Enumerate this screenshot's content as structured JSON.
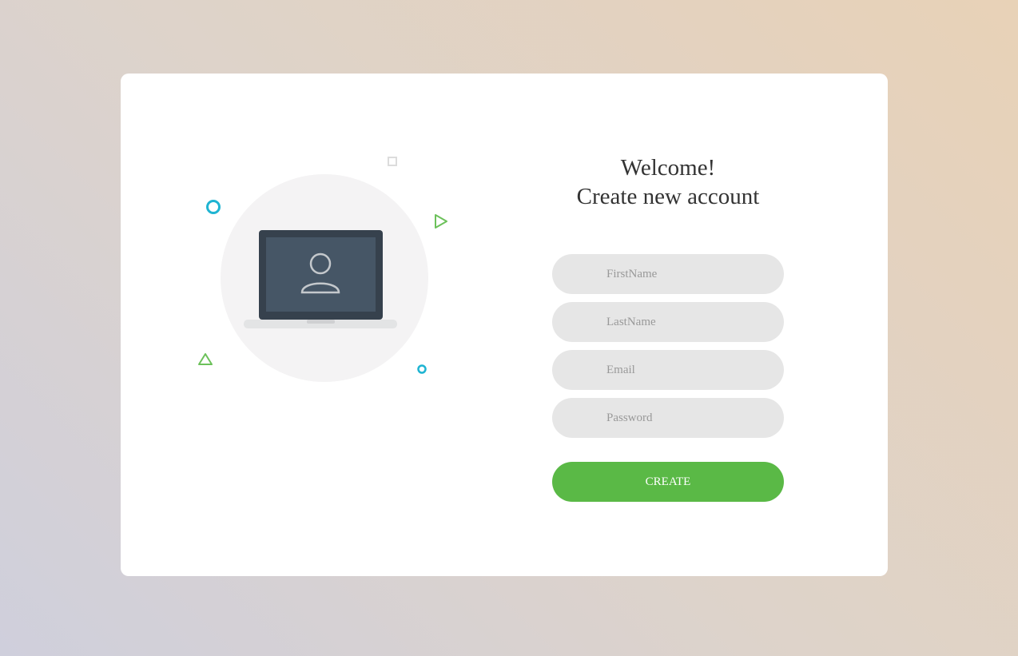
{
  "form": {
    "title_line1": "Welcome!",
    "title_line2": "Create new account",
    "fields": [
      {
        "placeholder": "FirstName",
        "value": ""
      },
      {
        "placeholder": "LastName",
        "value": ""
      },
      {
        "placeholder": "Email",
        "value": ""
      },
      {
        "placeholder": "Password",
        "value": ""
      }
    ],
    "submit_label": "CREATE"
  },
  "colors": {
    "accent_green": "#5ab946",
    "accent_cyan": "#1fb4d2",
    "field_bg": "#e6e6e6",
    "laptop_dark": "#36414d",
    "laptop_screen": "#465666"
  },
  "icons": {
    "hero": "laptop-user-icon",
    "decorations": [
      "ring-icon",
      "square-outline-icon",
      "triangle-right-icon",
      "triangle-up-icon",
      "small-ring-icon"
    ]
  }
}
